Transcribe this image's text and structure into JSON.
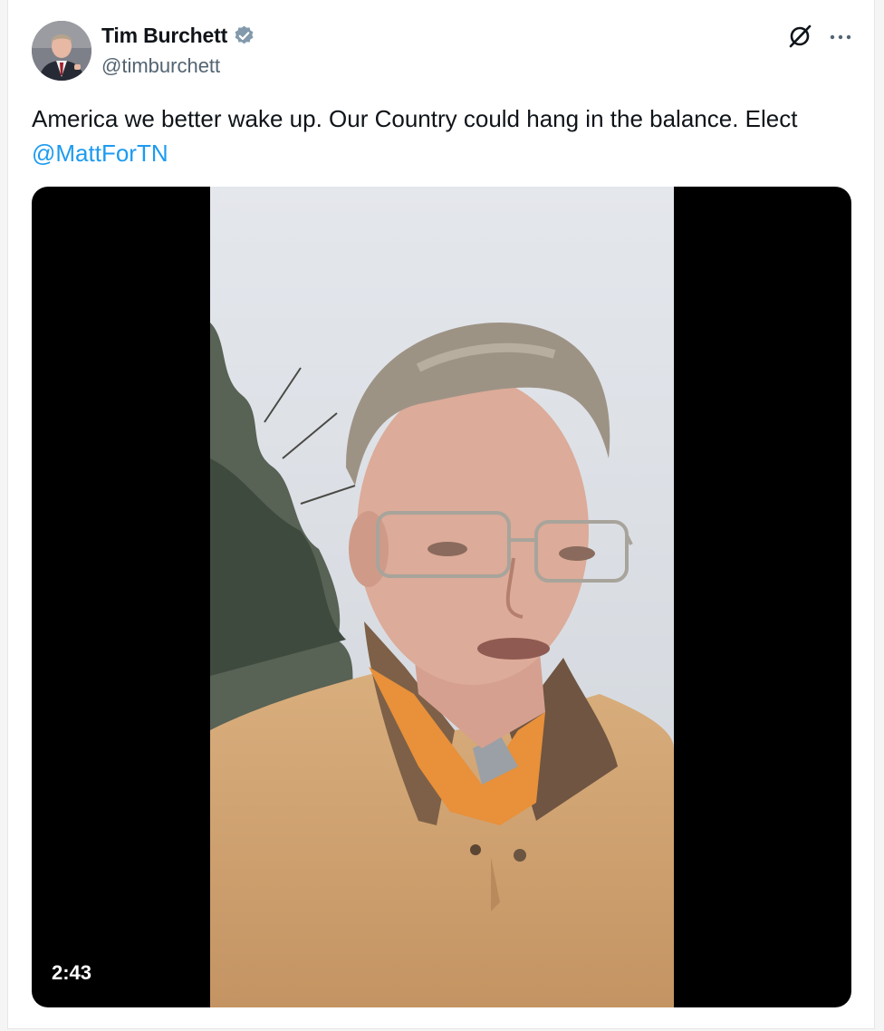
{
  "author": {
    "name": "Tim Burchett",
    "handle": "@timburchett",
    "verified_icon": "verified-badge-icon",
    "verified_color": "#829aab"
  },
  "tweet": {
    "text": "America we better wake up. Our Country could hang in the balance. Elect ",
    "mention": "@MattForTN"
  },
  "media": {
    "type": "video",
    "duration": "2:43"
  },
  "colors": {
    "link": "#1d9bf0",
    "text": "#0f1419",
    "secondary": "#536471"
  }
}
